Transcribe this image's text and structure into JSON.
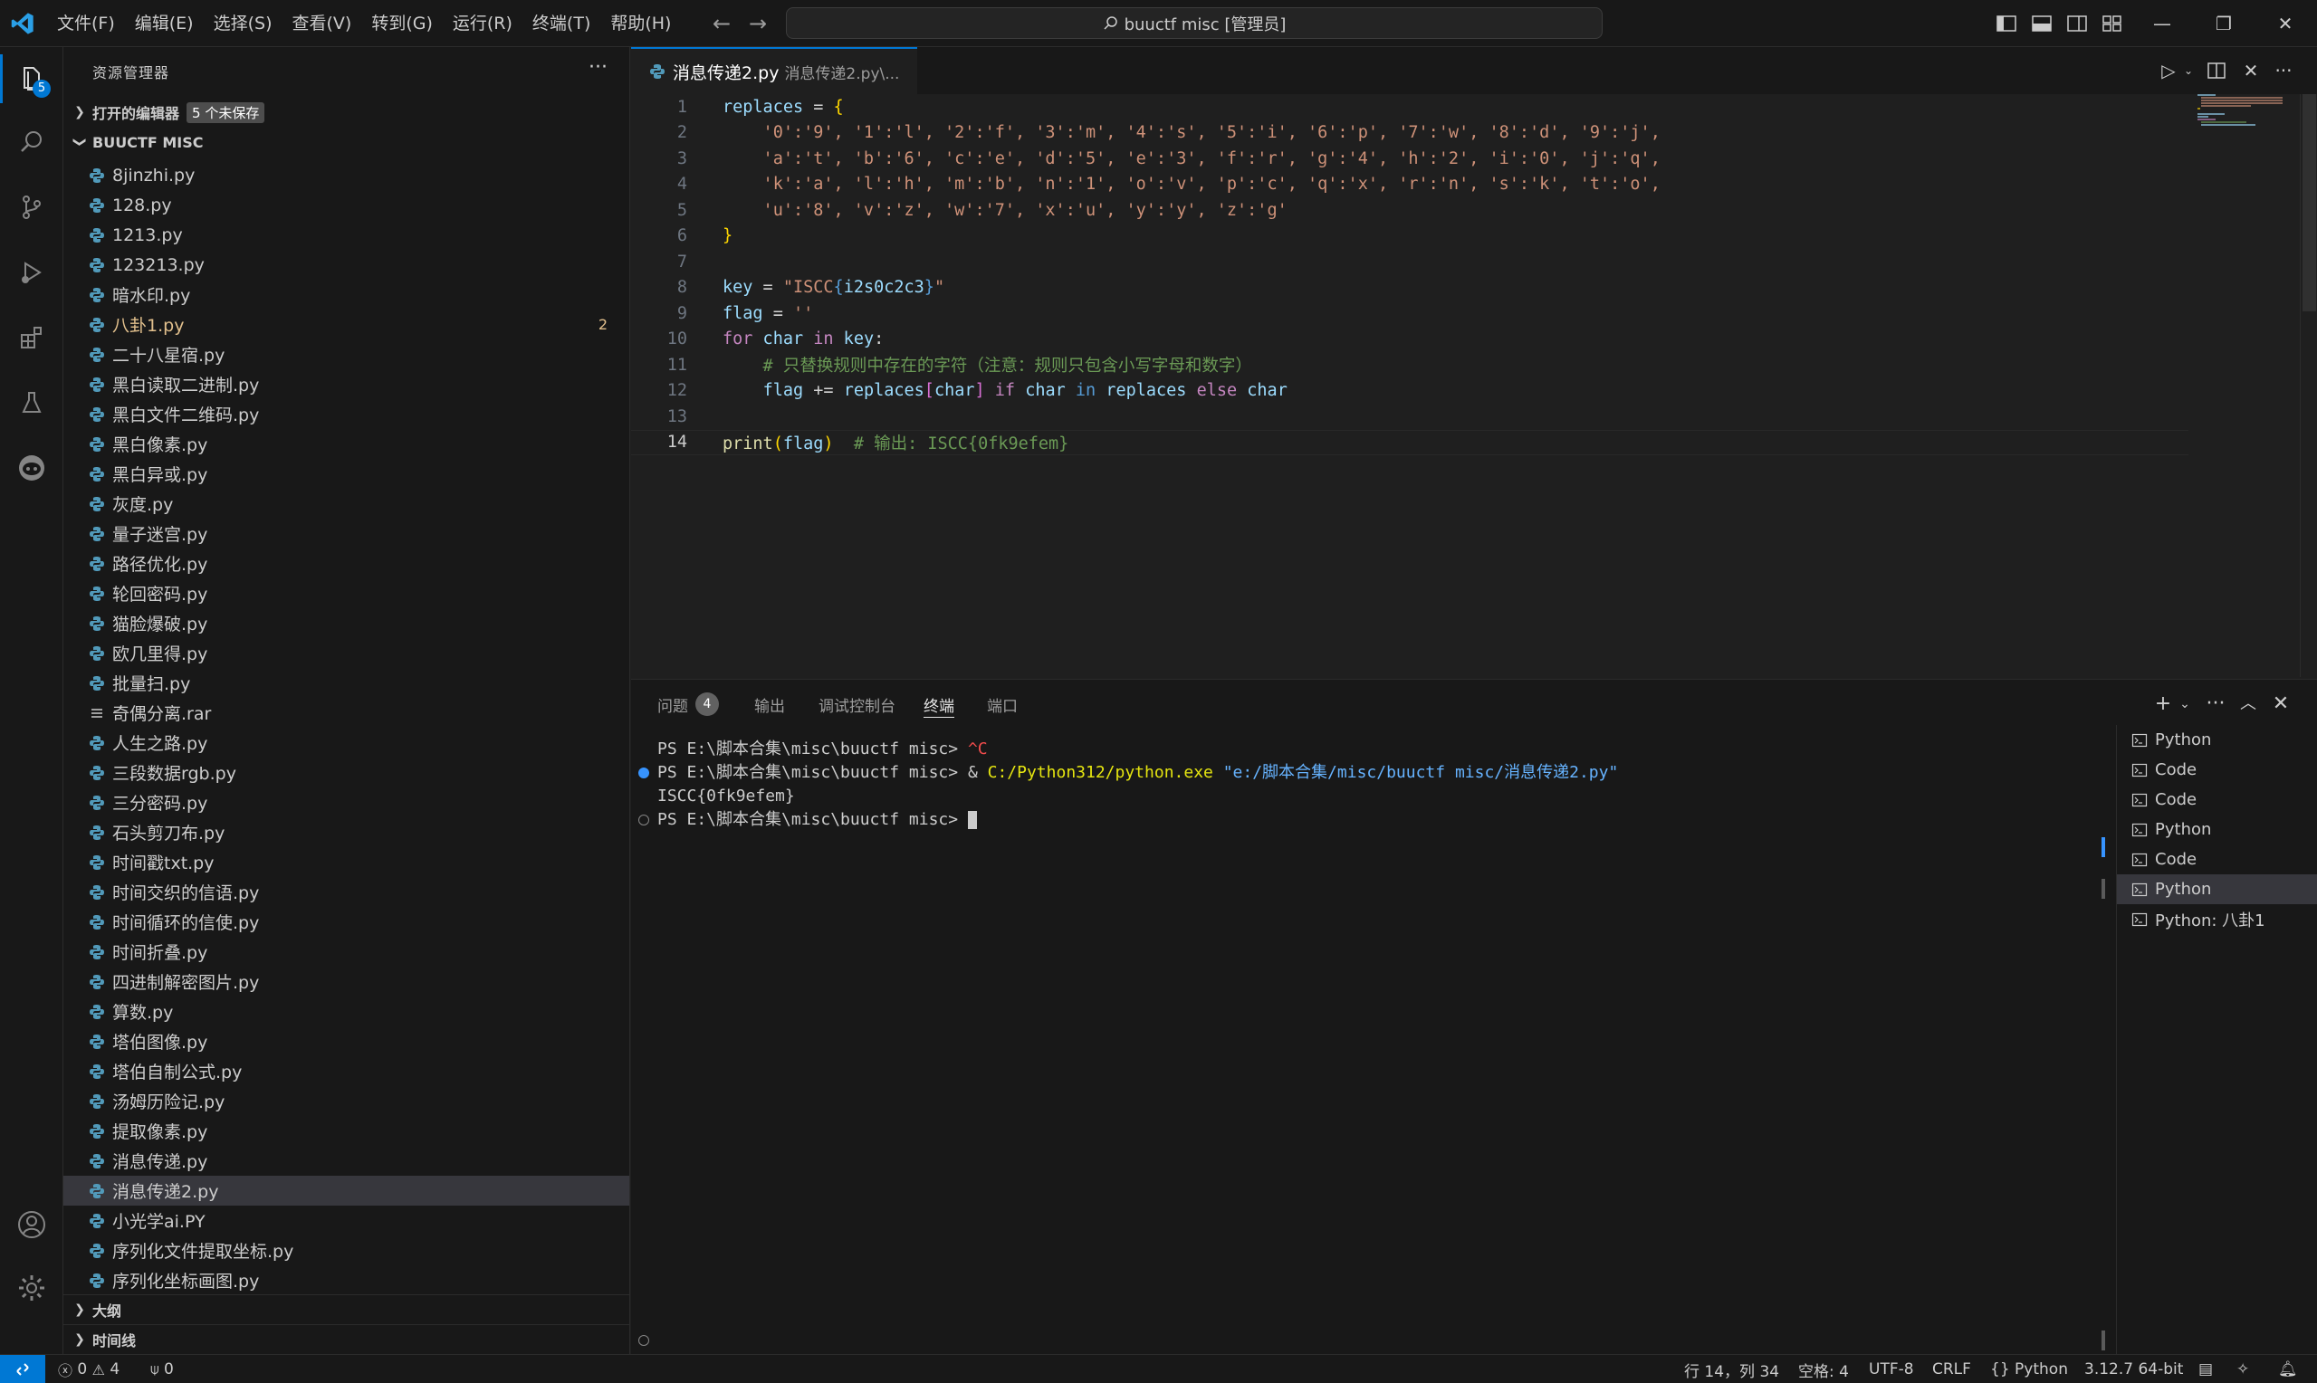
{
  "menu": [
    "文件(F)",
    "编辑(E)",
    "选择(S)",
    "查看(V)",
    "转到(G)",
    "运行(R)",
    "终端(T)",
    "帮助(H)"
  ],
  "command_center": "buuctf misc [管理员]",
  "activity": {
    "explorer_badge": "5"
  },
  "sidebar": {
    "title": "资源管理器",
    "open_editors": "打开的编辑器",
    "unsaved_badge": "5 个未保存",
    "folder": "BUUCTF MISC",
    "files": [
      {
        "name": "8jinzhi.py"
      },
      {
        "name": "128.py"
      },
      {
        "name": "1213.py"
      },
      {
        "name": "123213.py"
      },
      {
        "name": "暗水印.py"
      },
      {
        "name": "八卦1.py",
        "modified": true,
        "count": "2"
      },
      {
        "name": "二十八星宿.py"
      },
      {
        "name": "黑白读取二进制.py"
      },
      {
        "name": "黑白文件二维码.py"
      },
      {
        "name": "黑白像素.py"
      },
      {
        "name": "黑白异或.py"
      },
      {
        "name": "灰度.py"
      },
      {
        "name": "量子迷宫.py"
      },
      {
        "name": "路径优化.py"
      },
      {
        "name": "轮回密码.py"
      },
      {
        "name": "猫脸爆破.py"
      },
      {
        "name": "欧几里得.py"
      },
      {
        "name": "批量扫.py"
      },
      {
        "name": "奇偶分离.rar",
        "rar": true
      },
      {
        "name": "人生之路.py"
      },
      {
        "name": "三段数据rgb.py"
      },
      {
        "name": "三分密码.py"
      },
      {
        "name": "石头剪刀布.py"
      },
      {
        "name": "时间戳txt.py"
      },
      {
        "name": "时间交织的信语.py"
      },
      {
        "name": "时间循环的信使.py"
      },
      {
        "name": "时间折叠.py"
      },
      {
        "name": "四进制解密图片.py"
      },
      {
        "name": "算数.py"
      },
      {
        "name": "塔伯图像.py"
      },
      {
        "name": "塔伯自制公式.py"
      },
      {
        "name": "汤姆历险记.py"
      },
      {
        "name": "提取像素.py"
      },
      {
        "name": "消息传递.py"
      },
      {
        "name": "消息传递2.py",
        "selected": true
      },
      {
        "name": "小光学ai.PY"
      },
      {
        "name": "序列化文件提取坐标.py"
      },
      {
        "name": "序列化坐标画图.py"
      }
    ],
    "outline": "大纲",
    "timeline": "时间线"
  },
  "editor": {
    "tab_label": "消息传递2.py",
    "tab_path": "消息传递2.py\\...",
    "line_numbers": [
      "1",
      "2",
      "3",
      "4",
      "5",
      "6",
      "7",
      "8",
      "9",
      "10",
      "11",
      "12",
      "13",
      "14"
    ],
    "code": {
      "l1_var": "replaces",
      "l1_op": " = ",
      "l1_brace": "{",
      "l2": "    '0':'9', '1':'l', '2':'f', '3':'m', '4':'s', '5':'i', '6':'p', '7':'w', '8':'d', '9':'j',",
      "l3": "    'a':'t', 'b':'6', 'c':'e', 'd':'5', 'e':'3', 'f':'r', 'g':'4', 'h':'2', 'i':'0', 'j':'q',",
      "l4": "    'k':'a', 'l':'h', 'm':'b', 'n':'1', 'o':'v', 'p':'c', 'q':'x', 'r':'n', 's':'k', 't':'o',",
      "l5": "    'u':'8', 'v':'z', 'w':'7', 'x':'u', 'y':'y', 'z':'g'",
      "l6": "}",
      "l8_var": "key",
      "l8_op": " = ",
      "l8_str1": "\"ISCC",
      "l8_brace1": "{",
      "l8_inner": "i2s0c2c3",
      "l8_brace2": "}",
      "l8_str2": "\"",
      "l9_var": "flag",
      "l9_op": " = ",
      "l9_str": "''",
      "l10_kw": "for",
      "l10_var1": " char",
      "l10_in": " in",
      "l10_var2": " key",
      "l10_op": ":",
      "l11": "    # 只替换规则中存在的字符（注意：规则只包含小写字母和数字）",
      "l12_indent": "    ",
      "l12_var1": "flag",
      "l12_op1": " += ",
      "l12_var2": "replaces",
      "l12_b1": "[",
      "l12_var3": "char",
      "l12_b2": "]",
      "l12_if": " if",
      "l12_var4": " char",
      "l12_in": " in",
      "l12_var5": " replaces",
      "l12_else": " else",
      "l12_var6": " char",
      "l14_fn": "print",
      "l14_b1": "(",
      "l14_var": "flag",
      "l14_b2": ")",
      "l14_com": "  # 输出: ISCC{0fk9efem}"
    }
  },
  "panel": {
    "tabs": {
      "problems": "问题",
      "problems_count": "4",
      "output": "输出",
      "debug": "调试控制台",
      "terminal": "终端",
      "ports": "端口"
    },
    "terminal": {
      "l1_prompt": "PS E:\\脚本合集\\misc\\buuctf misc> ",
      "l1_cmd": "^C",
      "l2_prompt": "PS E:\\脚本合集\\misc\\buuctf misc> ",
      "l2_amp": "& ",
      "l2_exe": "C:/Python312/python.exe",
      "l2_arg": " \"e:/脚本合集/misc/buuctf misc/消息传递2.py\"",
      "l3": "ISCC{0fk9efem}",
      "l4_prompt": "PS E:\\脚本合集\\misc\\buuctf misc> "
    },
    "terminals": [
      {
        "name": "Python"
      },
      {
        "name": "Code"
      },
      {
        "name": "Code"
      },
      {
        "name": "Python"
      },
      {
        "name": "Code"
      },
      {
        "name": "Python",
        "selected": true
      },
      {
        "name": "Python: 八卦1"
      }
    ]
  },
  "statusbar": {
    "errors": "0",
    "warnings": "4",
    "ports": "0",
    "position": "行 14，列 34",
    "spaces": "空格: 4",
    "encoding": "UTF-8",
    "eol": "CRLF",
    "language": "Python",
    "interpreter": "3.12.7 64-bit"
  },
  "colors": {
    "accent": "#0078d4",
    "modified": "#e2c08d"
  }
}
